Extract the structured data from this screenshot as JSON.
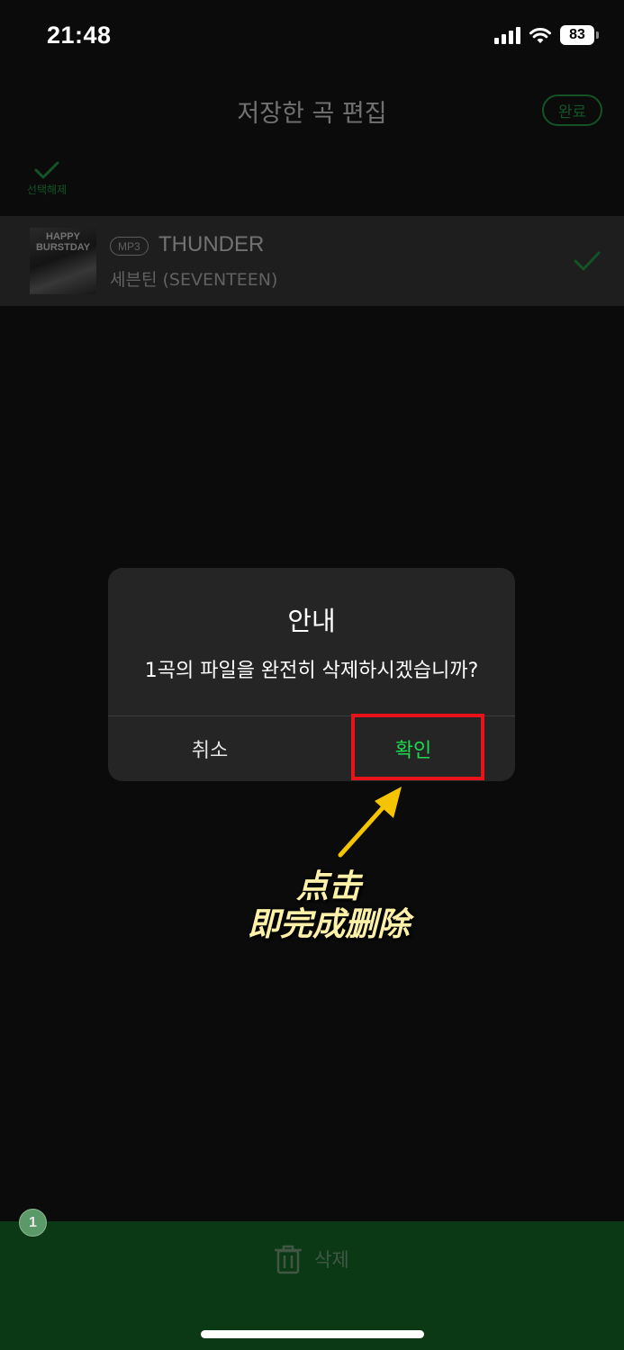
{
  "status_bar": {
    "time": "21:48",
    "battery": "83",
    "icons": [
      "signal-icon",
      "wifi-icon",
      "battery-icon"
    ]
  },
  "header": {
    "title": "저장한 곡 편집",
    "done_label": "완료"
  },
  "select_all": {
    "label": "선택해제",
    "icon": "check-icon"
  },
  "song": {
    "album_art_text": "HAPPY BURSTDAY",
    "format_badge": "MP3",
    "title": "THUNDER",
    "artist": "세븐틴 (SEVENTEEN)",
    "selected": true
  },
  "dialog": {
    "title": "안내",
    "message": "1곡의 파일을 완전히 삭제하시겠습니까?",
    "cancel_label": "취소",
    "confirm_label": "확인"
  },
  "bottom_bar": {
    "count": "1",
    "delete_label": "삭제",
    "icon": "trash-icon"
  },
  "annotation": {
    "line1": "点击",
    "line2": "即完成删除"
  },
  "colors": {
    "accent_green": "#1db94b",
    "bottom_bar": "#0d7a24",
    "highlight_red": "#e8121b",
    "annotation_yellow": "#fff2a8"
  }
}
